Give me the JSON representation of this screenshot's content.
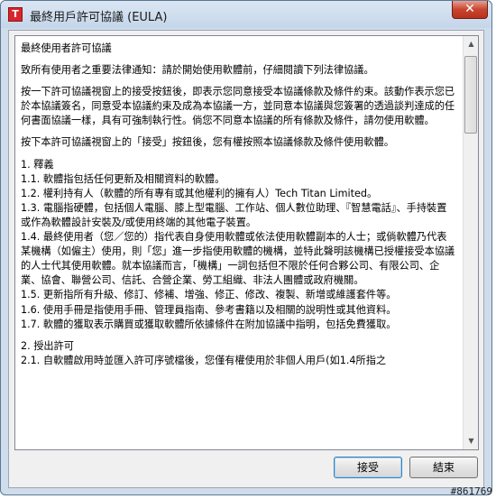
{
  "window": {
    "title": "最終用戶許可協議 (EULA)",
    "app_icon_glyph": "T",
    "close_glyph": "✕"
  },
  "eula": {
    "paragraphs": [
      "最終使用者許可協議",
      "致所有使用者之重要法律通知：請於開始使用軟體前，仔細閱讀下列法律協議。",
      "按一下許可協議視窗上的接受按鈕後，即表示您同意接受本協議條款及條件約束。該動作表示您已於本協議簽名，同意受本協議約束及成為本協議一方，並同意本協議與您簽署的透過談判達成的任何書面協議一樣，具有可強制執行性。倘您不同意本協議的所有條款及條件，請勿使用軟體。",
      "按下本許可協議視窗上的「接受」按鈕後，您有權按照本協議條款及條件使用軟體。",
      "1. 釋義\n1.1. 軟體指包括任何更新及相關資料的軟體。\n1.2. 權利持有人（軟體的所有專有或其他權利的擁有人）Tech Titan Limited。\n1.3. 電腦指硬體，包括個人電腦、膝上型電腦、工作站、個人數位助理、『智慧電話』、手持裝置或作為軟體設計安裝及/或使用終端的其他電子裝置。\n1.4. 最終使用者（您／您的）指代表自身使用軟體或依法使用軟體副本的人士；或倘軟體乃代表某機構（如僱主）使用，則「您」進一步指使用軟體的機構，並特此聲明該機構已授權接受本協議的人士代其使用軟體。就本協議而言，「機構」一詞包括但不限於任何合夥公司、有限公司、企業、協會、聯營公司、信託、合營企業、勞工組織、非法人團體或政府機關。\n1.5. 更新指所有升級、修訂、修補、增強、修正、修改、複製、新增或維護套件等。\n1.6. 使用手冊是指使用手冊、管理員指南、參考書籍以及相關的說明性或其他資料。\n1.7. 軟體的獲取表示購買或獲取軟體所依據條件在附加協議中指明，包括免費獲取。",
      "2. 授出許可\n2.1. 自軟體啟用時並匯入許可序號檔後，您僅有權使用於非個人用戶(如1.4所指之"
    ]
  },
  "buttons": {
    "accept_label": "接受",
    "close_label": "結束"
  },
  "watermark": "#861769"
}
